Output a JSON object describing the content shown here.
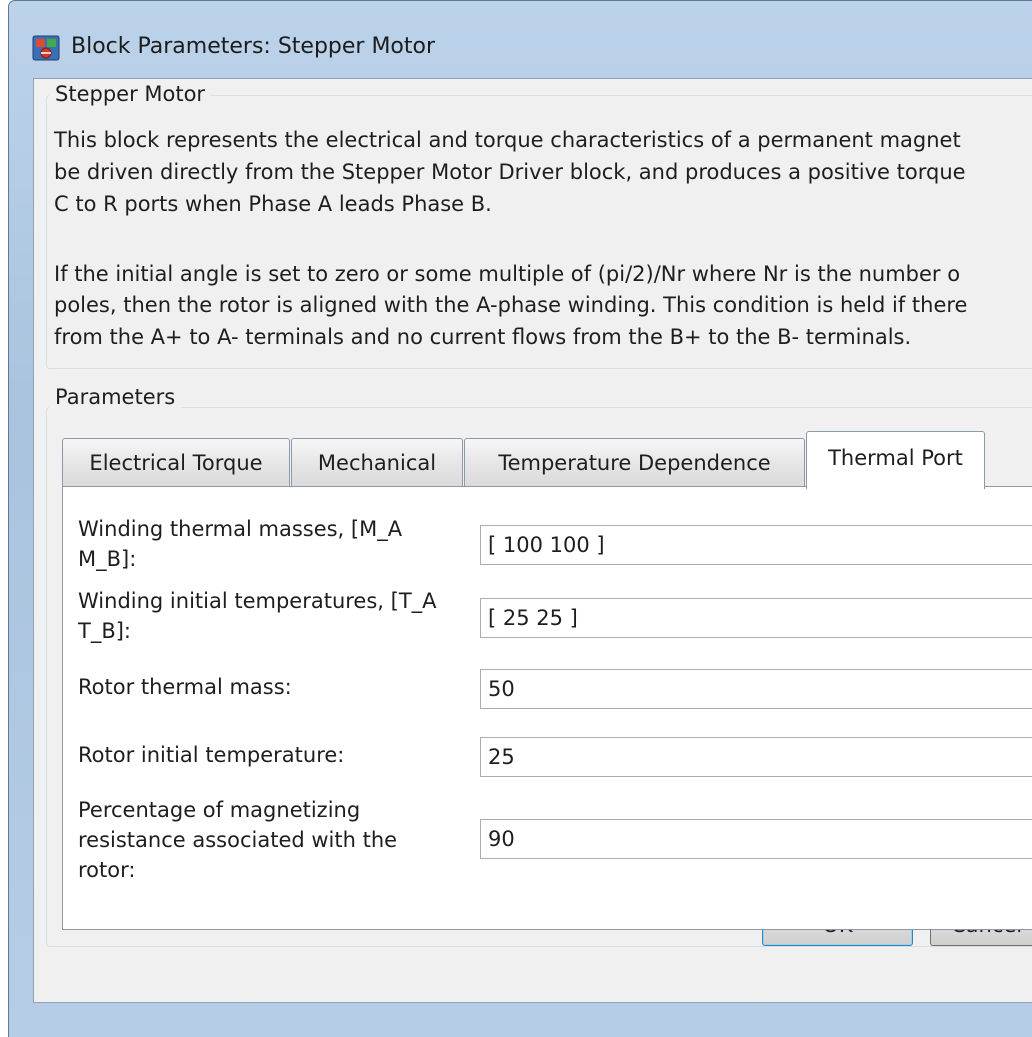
{
  "window": {
    "title": "Block Parameters: Stepper Motor",
    "icon": "simulink-block-icon"
  },
  "description": {
    "group_label": "Stepper Motor",
    "paragraph1": [
      "This block represents the electrical and torque characteristics of a permanent magnet",
      "be driven directly from the Stepper Motor Driver block, and produces a positive torque",
      "C to R ports when Phase A leads Phase B."
    ],
    "paragraph2": [
      "If the initial angle is set to zero or some multiple of (pi/2)/Nr where Nr is the number o",
      "poles, then the rotor is aligned with the A-phase winding. This condition is held if there",
      "from the A+ to A- terminals and no current flows from the B+ to the B- terminals."
    ]
  },
  "parameters": {
    "group_label": "Parameters",
    "tabs": [
      {
        "label": "Electrical Torque",
        "active": false
      },
      {
        "label": "Mechanical",
        "active": false
      },
      {
        "label": "Temperature Dependence",
        "active": false
      },
      {
        "label": "Thermal Port",
        "active": true
      }
    ],
    "fields": [
      {
        "label": "Winding thermal masses, [M_A M_B]:",
        "value": "[ 100 100 ]"
      },
      {
        "label": "Winding initial temperatures, [T_A T_B]:",
        "value": "[ 25 25 ]"
      },
      {
        "label": "Rotor thermal mass:",
        "value": "50"
      },
      {
        "label": "Rotor initial temperature:",
        "value": "25"
      },
      {
        "label": "Percentage of magnetizing resistance associated with the rotor:",
        "value": "90"
      }
    ]
  },
  "buttons": {
    "ok": "OK",
    "cancel": "Cancel"
  }
}
